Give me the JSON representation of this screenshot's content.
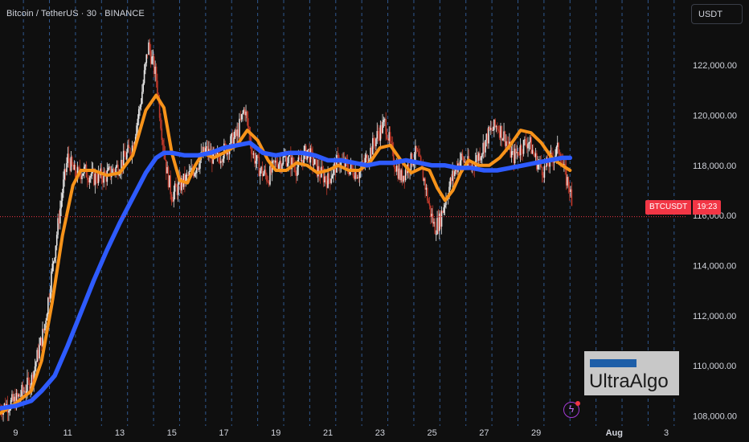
{
  "header": {
    "symbol_title": "Bitcoin / TetherUS · 30 · BINANCE"
  },
  "currency_button": {
    "label": "USDT"
  },
  "price_tag": {
    "symbol": "BTCUSDT",
    "timer": "19:23"
  },
  "logo": {
    "text": "UltraAlgo"
  },
  "icons": {
    "alert": "lightning-icon"
  },
  "colors": {
    "background": "#0f0f0f",
    "up_candle": "#e8e8e8",
    "down_candle": "#c0392b",
    "fast_ma": "#f7931a",
    "slow_ma": "#2e5bff",
    "session_line": "#3a6fb8",
    "last_price": "#f23645"
  },
  "chart_data": {
    "type": "line",
    "title": "Bitcoin / TetherUS · 30 · BINANCE",
    "ylim": [
      107600,
      124600
    ],
    "y_ticks": [
      108000,
      110000,
      112000,
      114000,
      116000,
      118000,
      120000,
      122000
    ],
    "y_tick_labels": [
      "108,000.00",
      "110,000.00",
      "112,000.00",
      "114,000.00",
      "116,000.00",
      "118,000.00",
      "120,000.00",
      "122,000.00"
    ],
    "x_ticks": [
      9,
      11,
      13,
      15,
      17,
      19,
      21,
      23,
      25,
      27,
      29,
      32,
      34
    ],
    "x_tick_labels": [
      "9",
      "11",
      "13",
      "15",
      "17",
      "19",
      "21",
      "23",
      "25",
      "27",
      "29",
      "Aug",
      "3"
    ],
    "xlim": [
      8.4,
      34.8
    ],
    "session_lines_x": [
      9.3,
      10.3,
      11.3,
      12.3,
      13.3,
      14.3,
      15.3,
      16.3,
      17.3,
      18.3,
      19.3,
      20.3,
      21.3,
      22.3,
      23.3,
      24.3,
      25.3,
      26.3,
      27.3,
      28.3,
      29.3,
      30.3,
      31.3,
      32.3,
      33.3,
      34.3
    ],
    "last_price": 115950,
    "price_series": {
      "x": [
        8.4,
        9.0,
        9.6,
        10.1,
        10.4,
        10.8,
        11.0,
        11.3,
        11.6,
        12.0,
        12.5,
        13.0,
        13.5,
        13.8,
        14.1,
        14.4,
        14.6,
        14.8,
        15.0,
        15.3,
        15.6,
        15.9,
        16.3,
        16.7,
        17.1,
        17.5,
        17.8,
        18.1,
        18.4,
        18.7,
        19.0,
        19.4,
        19.8,
        20.2,
        20.6,
        21.0,
        21.4,
        21.8,
        22.2,
        22.6,
        22.9,
        23.2,
        23.5,
        23.8,
        24.1,
        24.4,
        24.7,
        24.9,
        25.1,
        25.3,
        25.5,
        25.8,
        26.1,
        26.5,
        26.9,
        27.2,
        27.5,
        27.8,
        28.1,
        28.4,
        28.7,
        29.0,
        29.3,
        29.6,
        29.9,
        30.1,
        30.3,
        30.4
      ],
      "y": [
        108300,
        108600,
        109400,
        111500,
        113800,
        117000,
        118300,
        117600,
        117800,
        117500,
        117600,
        118000,
        118800,
        120500,
        122800,
        121500,
        119500,
        117800,
        116800,
        117200,
        117500,
        117900,
        118600,
        118200,
        118700,
        119200,
        120300,
        118500,
        117800,
        117500,
        118100,
        118300,
        117900,
        118600,
        117800,
        117400,
        118200,
        117900,
        117700,
        118500,
        119200,
        119700,
        118300,
        117500,
        118000,
        118500,
        117400,
        116300,
        115500,
        115800,
        116600,
        117600,
        118300,
        117900,
        118600,
        119300,
        119600,
        119100,
        118300,
        118700,
        119000,
        118200,
        117800,
        118300,
        118700,
        117600,
        117100,
        115900
      ]
    },
    "series": [
      {
        "name": "",
        "x": [
          8.4,
          9.0,
          9.6,
          10.0,
          10.4,
          10.8,
          11.2,
          11.5,
          12.0,
          12.5,
          13.0,
          13.5,
          14.0,
          14.4,
          14.7,
          15.0,
          15.3,
          15.6,
          15.9,
          16.2,
          16.6,
          17.0,
          17.5,
          17.9,
          18.3,
          18.7,
          19.0,
          19.4,
          19.8,
          20.2,
          20.6,
          21.0,
          21.4,
          21.8,
          22.2,
          22.6,
          23.0,
          23.4,
          23.8,
          24.2,
          24.6,
          24.9,
          25.2,
          25.5,
          25.8,
          26.1,
          26.4,
          26.8,
          27.2,
          27.6,
          28.0,
          28.4,
          28.8,
          29.2,
          29.6,
          30.0,
          30.3
        ],
        "y": [
          108100,
          108500,
          109000,
          110200,
          112500,
          115200,
          117200,
          117800,
          117800,
          117600,
          117700,
          118400,
          120200,
          120800,
          120300,
          118500,
          117400,
          117300,
          118000,
          118500,
          118300,
          118500,
          118800,
          119400,
          119000,
          118200,
          117800,
          117800,
          118100,
          118000,
          117700,
          117800,
          118000,
          117800,
          117800,
          118100,
          118700,
          118800,
          118200,
          117700,
          117900,
          117800,
          117100,
          116600,
          117000,
          117700,
          118200,
          118000,
          118000,
          118300,
          118800,
          119400,
          119300,
          118900,
          118300,
          118000,
          117800
        ]
      },
      {
        "name": "",
        "x": [
          8.4,
          9.0,
          9.6,
          10.0,
          10.5,
          11.0,
          11.5,
          12.0,
          12.5,
          13.0,
          13.5,
          14.0,
          14.4,
          14.7,
          15.0,
          15.5,
          16.0,
          16.5,
          17.0,
          17.5,
          18.0,
          18.5,
          19.0,
          19.5,
          20.0,
          20.5,
          21.0,
          21.5,
          22.0,
          22.5,
          23.0,
          23.5,
          24.0,
          24.5,
          25.0,
          25.5,
          26.0,
          26.5,
          27.0,
          27.5,
          28.0,
          28.5,
          29.0,
          29.5,
          30.0,
          30.3
        ],
        "y": [
          108300,
          108400,
          108600,
          109000,
          109600,
          110800,
          112100,
          113400,
          114600,
          115700,
          116700,
          117700,
          118300,
          118500,
          118500,
          118400,
          118400,
          118500,
          118700,
          118800,
          118900,
          118500,
          118400,
          118500,
          118500,
          118400,
          118200,
          118200,
          118100,
          118000,
          118100,
          118100,
          118200,
          118100,
          118000,
          118000,
          117900,
          117900,
          117800,
          117800,
          117900,
          118000,
          118100,
          118200,
          118300,
          118300
        ]
      }
    ]
  }
}
